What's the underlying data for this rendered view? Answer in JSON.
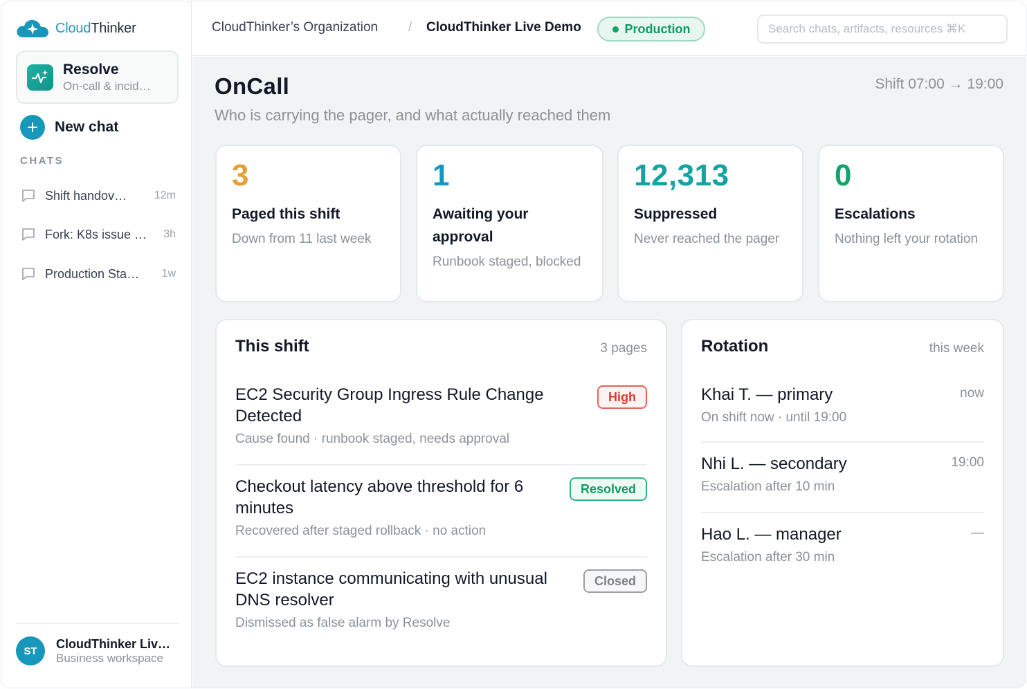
{
  "brand": {
    "part1": "Cloud",
    "part2": "Thinker"
  },
  "agent": {
    "title": "Resolve",
    "subtitle": "On-call & incid…"
  },
  "new_chat_label": "New chat",
  "chats_section_label": "CHATS",
  "chats": [
    {
      "title": "Shift handov…",
      "time": "12m"
    },
    {
      "title": "Fork: K8s issue …",
      "time": "3h"
    },
    {
      "title": "Production Sta…",
      "time": "1w"
    }
  ],
  "workspace": {
    "initials": "ST",
    "name": "CloudThinker Liv…",
    "type": "Business workspace"
  },
  "breadcrumb": {
    "org": "CloudThinker’s Organization",
    "separator": "/",
    "project": "CloudThinker Live Demo"
  },
  "environment": {
    "label": "Production",
    "color": "#16a36b"
  },
  "search": {
    "placeholder": "Search chats, artifacts, resources ⌘K",
    "value": ""
  },
  "page": {
    "title": "OnCall",
    "subtitle": "Who is carrying the pager, and what actually reached them",
    "shift": "Shift 07:00 → 19:00"
  },
  "stats": [
    {
      "value": "3",
      "title": "Paged this shift",
      "description": "Down from 11 last week",
      "color": "#e3a13a"
    },
    {
      "value": "1",
      "title": "Awaiting your approval",
      "description": "Runbook staged, blocked",
      "color": "#1797b9"
    },
    {
      "value": "12,313",
      "title": "Suppressed",
      "description": "Never reached the pager",
      "color": "#16a3a0"
    },
    {
      "value": "0",
      "title": "Escalations",
      "description": "Nothing left your rotation",
      "color": "#16a36b"
    }
  ],
  "this_shift": {
    "title": "This shift",
    "meta": "3 pages",
    "incidents": [
      {
        "title": "EC2 Security Group Ingress Rule Change Detected",
        "detail": "Cause found · runbook staged, needs approval",
        "badge": "High"
      },
      {
        "title": "Checkout latency above threshold for 6 minutes",
        "detail": "Recovered after staged rollback · no action",
        "badge": "Resolved"
      },
      {
        "title": "EC2 instance communicating with unusual DNS resolver",
        "detail": "Dismissed as false alarm by Resolve",
        "badge": "Closed"
      }
    ]
  },
  "rotation": {
    "title": "Rotation",
    "meta": "this week",
    "people": [
      {
        "name": "Khai T. — primary",
        "status": "On shift now · until 19:00",
        "time": "now"
      },
      {
        "name": "Nhi L. — secondary",
        "status": "Escalation after 10 min",
        "time": "19:00"
      },
      {
        "name": "Hao L. — manager",
        "status": "Escalation after 30 min",
        "time": "—"
      }
    ]
  }
}
